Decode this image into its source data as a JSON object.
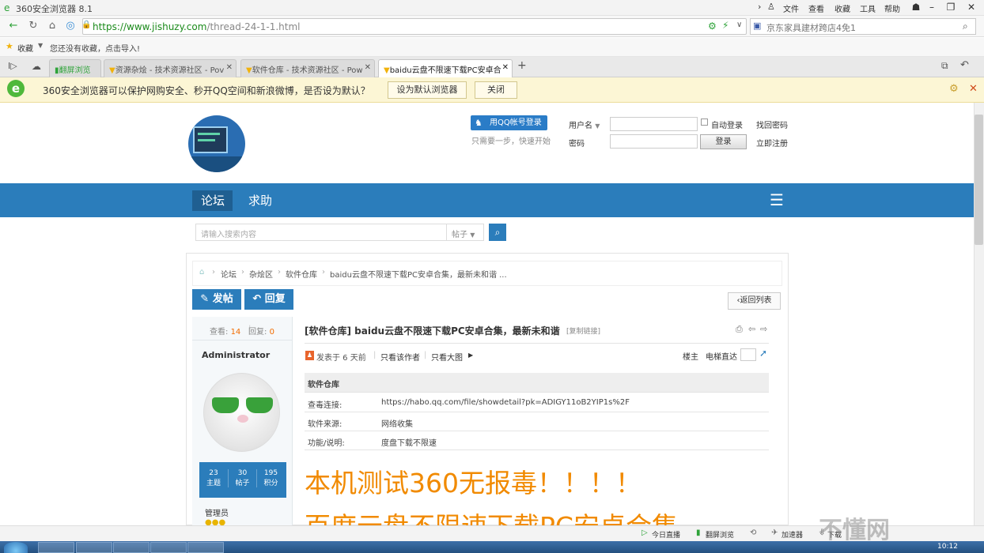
{
  "browser": {
    "title": "360安全浏览器 8.1",
    "menus": [
      "文件",
      "查看",
      "收藏",
      "工具",
      "帮助"
    ],
    "url_host": "https://www.jishuzy.com",
    "url_path": "/thread-24-1-1.html",
    "search_text": "京东家具建材跨店4免1",
    "fav_label": "收藏",
    "fav_hint": "您还没有收藏，点击导入!",
    "tabs": [
      {
        "label": "翻屏浏览"
      },
      {
        "label": "资源杂烩 - 技术资源社区 - Pov"
      },
      {
        "label": "软件仓库 - 技术资源社区 - Pow"
      },
      {
        "label": "baidu云盘不限速下载PC安卓合"
      }
    ],
    "notice": {
      "text": "360安全浏览器可以保护网购安全、秒开QQ空间和新浪微博，是否设为默认？",
      "set_default": "设为默认浏览器",
      "close": "关闭"
    },
    "status_items": [
      "今日直播",
      "翻屏浏览",
      "加速器",
      "下载"
    ],
    "clock": "10:12"
  },
  "login": {
    "qq_button": "用QQ帐号登录",
    "qq_hint": "只需要一步，快速开始",
    "username_label": "用户名",
    "password_label": "密码",
    "auto_login": "自动登录",
    "find_password": "找回密码",
    "login_button": "登录",
    "register": "立即注册"
  },
  "nav": {
    "items": [
      "论坛",
      "求助"
    ]
  },
  "search": {
    "placeholder": "请输入搜索内容",
    "type": "帖子"
  },
  "breadcrumb": [
    "论坛",
    "杂烩区",
    "软件仓库",
    "baidu云盘不限速下载PC安卓合集，最新未和谐 ..."
  ],
  "post_buttons": {
    "new_post": "发帖",
    "reply": "回复",
    "back_list": "返回列表"
  },
  "stats": {
    "view_label": "查看:",
    "views": "14",
    "reply_label": "回复:",
    "replies": "0"
  },
  "author": {
    "name": "Administrator",
    "role": "管理员",
    "counters": [
      {
        "value": "23",
        "label": "主题"
      },
      {
        "value": "30",
        "label": "帖子"
      },
      {
        "value": "195",
        "label": "积分"
      }
    ]
  },
  "thread": {
    "title": "[软件仓库] baidu云盘不限速下载PC安卓合集，最新未和谐",
    "copy_link": "[复制链接]",
    "posted": "发表于 6 天前",
    "only_author": "只看该作者",
    "only_image": "只看大图",
    "floor": "楼主",
    "elevator": "电梯直达",
    "table_header": "软件仓库",
    "rows": [
      {
        "k": "查毒连接:",
        "v": "https://habo.qq.com/file/showdetail?pk=ADIGY11oB2YIP1s%2F"
      },
      {
        "k": "软件来源:",
        "v": "网络收集"
      },
      {
        "k": "功能/说明:",
        "v": "度盘下载不限速"
      }
    ],
    "big_line1": "本机测试360无报毒！！！！",
    "big_line2": "百度云盘不限速下载PC安卓合集"
  },
  "watermark": "不懂网"
}
